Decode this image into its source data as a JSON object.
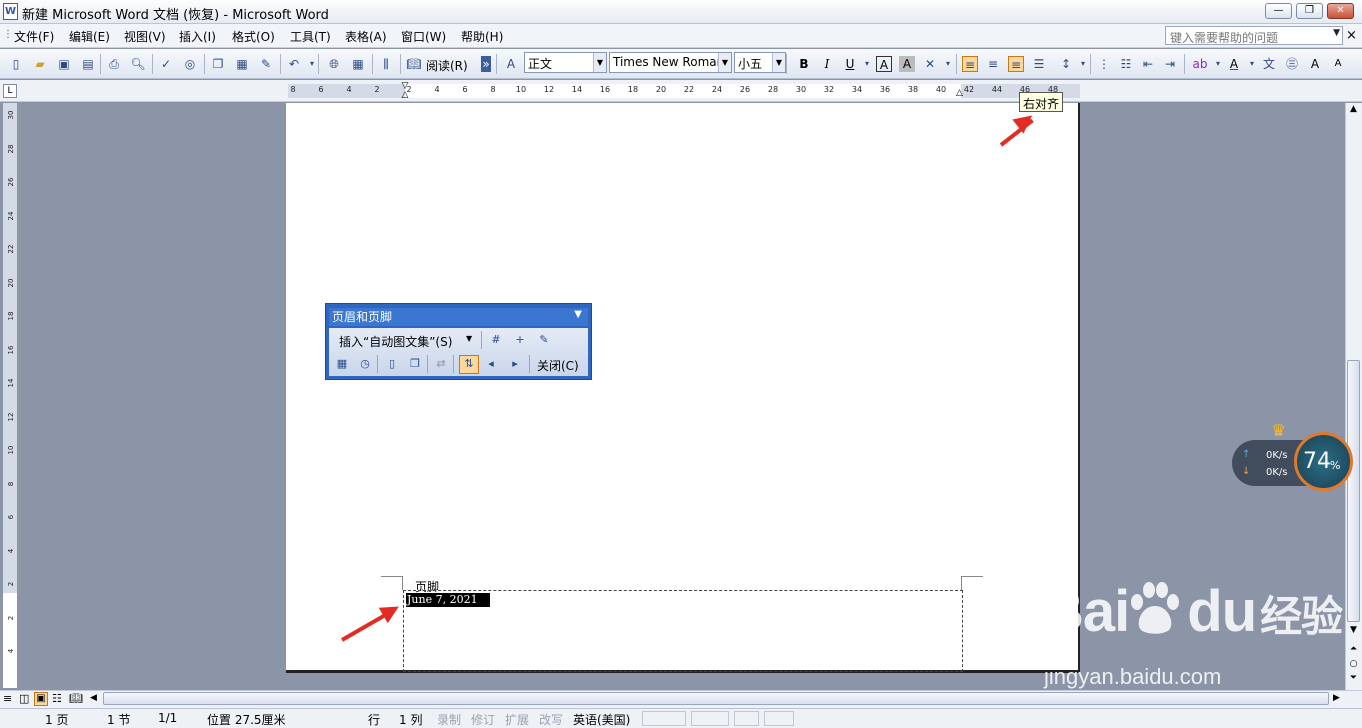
{
  "window": {
    "title": "新建 Microsoft Word 文档 (恢复) - Microsoft Word",
    "min": "—",
    "restore": "❐",
    "close": "✕"
  },
  "menu": {
    "items": [
      "文件(F)",
      "编辑(E)",
      "视图(V)",
      "插入(I)",
      "格式(O)",
      "工具(T)",
      "表格(A)",
      "窗口(W)",
      "帮助(H)"
    ],
    "help_placeholder": "键入需要帮助的问题",
    "close": "×"
  },
  "toolbar": {
    "read_label": "阅读(R)",
    "style_value": "正文",
    "font_value": "Times New Roman",
    "size_value": "小五"
  },
  "tooltip": "右对齐",
  "ruler": {
    "h_ticks": [
      "8",
      "6",
      "4",
      "2",
      "2",
      "4",
      "6",
      "8",
      "10",
      "12",
      "14",
      "16",
      "18",
      "20",
      "22",
      "24",
      "26",
      "28",
      "30",
      "32",
      "34",
      "36",
      "38",
      "40",
      "42",
      "44",
      "46",
      "48"
    ],
    "v_ticks": [
      "30",
      "28",
      "26",
      "24",
      "22",
      "20",
      "18",
      "16",
      "14",
      "12",
      "10",
      "8",
      "6",
      "4",
      "2",
      "2",
      "4"
    ]
  },
  "hf_toolbar": {
    "title": "页眉和页脚",
    "insert_autotext": "插入“自动图文集”(S)",
    "close": "关闭(C)"
  },
  "document": {
    "footer_label": "页脚",
    "footer_date": "June 7, 2021"
  },
  "status": {
    "page": "1 页",
    "section": "1 节",
    "page_of": "1/1",
    "position": "位置 27.5厘米",
    "line": "行",
    "col": "1 列",
    "rec": "录制",
    "trk": "修订",
    "ext": "扩展",
    "ovr": "改写",
    "lang": "英语(美国)"
  },
  "net_widget": {
    "up": "0K/s",
    "down": "0K/s",
    "percent": "74",
    "unit": "%"
  },
  "watermark": {
    "logo": "Bai",
    "logo2": "du",
    "cn": "经验",
    "url": "jingyan.baidu.com"
  }
}
